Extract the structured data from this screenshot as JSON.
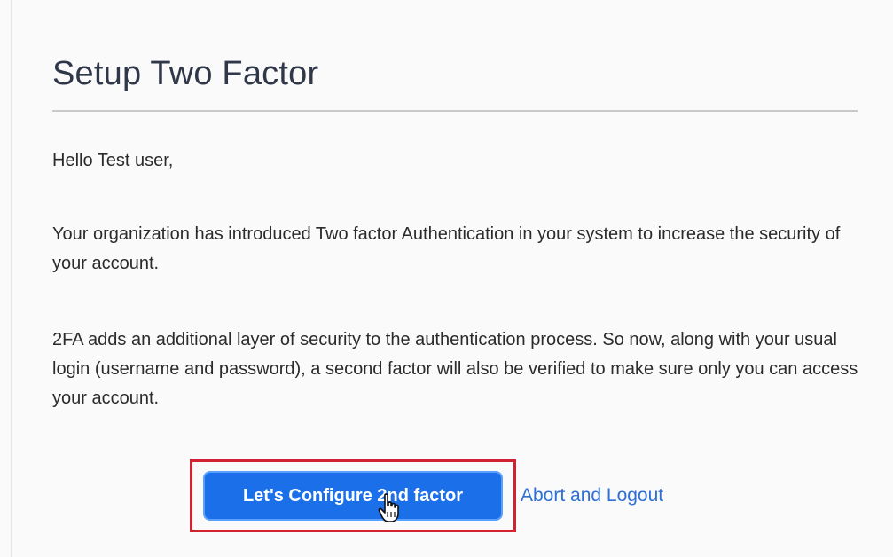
{
  "page": {
    "title": "Setup Two Factor",
    "greeting": "Hello Test user,",
    "intro": "Your organization has introduced Two factor Authentication in your system to increase the security of your account.",
    "detail": "2FA adds an additional layer of security to the authentication process. So now, along with your usual login (username and password), a second factor will also be verified to make sure only you can access your account."
  },
  "actions": {
    "configure_label": "Let's Configure 2nd factor",
    "abort_label": "Abort and Logout"
  },
  "colors": {
    "primary_button": "#1b6fe8",
    "link": "#2d6fd2",
    "highlight": "#d0222f"
  },
  "icons": {
    "cursor": "hand-pointer-icon"
  }
}
